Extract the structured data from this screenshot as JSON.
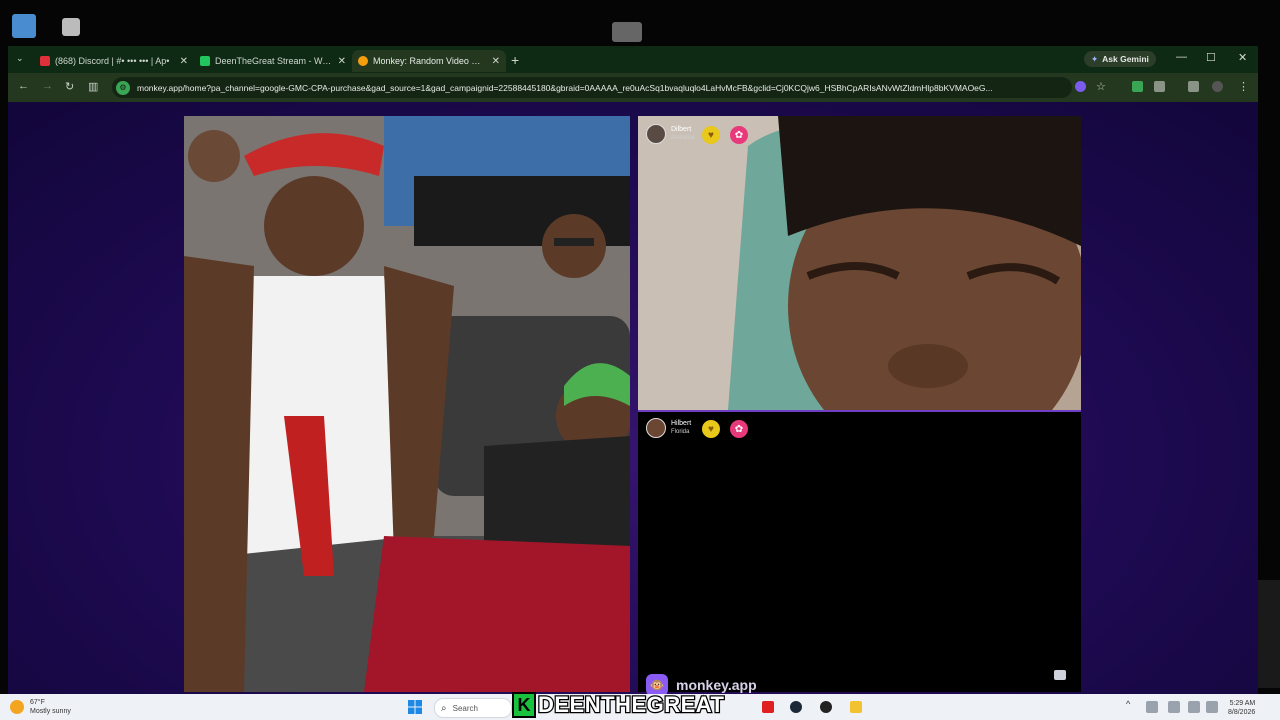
{
  "browser": {
    "tabs": [
      {
        "label": "(868) Discord | #• ••• ••• | Ap•",
        "favicon_color": "#e0303a",
        "active": false
      },
      {
        "label": "DeenTheGreat Stream - Watc•",
        "favicon_color": "#22c55e",
        "active": false
      },
      {
        "label": "Monkey: Random Video Ch•",
        "favicon_color": "#f59e0b",
        "active": true
      }
    ],
    "new_tab_glyph": "+",
    "gemini_label": "Ask Gemini",
    "url": "monkey.app/home?pa_channel=google-GMC-CPA-purchase&gad_source=1&gad_campaignid=22588445180&gbraid=0AAAAA_re0uAcSq1bvaqluqlo4LaHvMcFB&gclid=Cj0KCQjw6_HSBhCpARIsANvWtZldmHlp8bKVMAOeG..."
  },
  "call": {
    "remote_user": {
      "name": "Dilbert",
      "location": "Alabama"
    },
    "self_user": {
      "name": "Hilbert",
      "location": "Florida"
    },
    "brand": "monkey.app"
  },
  "taskbar": {
    "weather_temp": "67°F",
    "weather_desc": "Mostly sunny",
    "search_placeholder": "Search",
    "time": "5:29 AM",
    "date": "8/8/2026"
  },
  "watermark": {
    "k": "K",
    "text": "DEENTHEGREAT"
  },
  "colors": {
    "accent_purple": "#6f3ec4",
    "browser_frame": "#0f2a14",
    "heart_badge": "#e8c81a",
    "gift_badge": "#e83a7a"
  }
}
